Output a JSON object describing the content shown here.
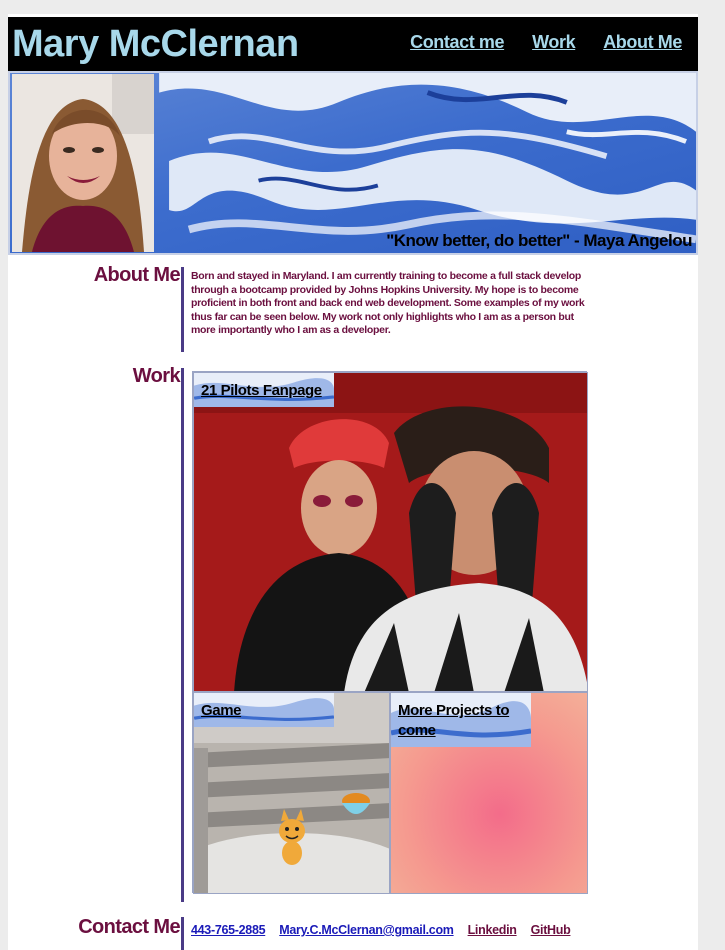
{
  "header": {
    "title": "Mary McClernan",
    "nav": [
      "Contact me",
      "Work",
      "About Me"
    ]
  },
  "hero": {
    "quote": "\"Know better, do better\" - Maya Angelou"
  },
  "about": {
    "heading": "About Me",
    "text": "Born and stayed in Maryland. I am currently training to become a full stack develop through a bootcamp provided by Johns Hopkins University. My hope is to become proficient in both front and back end web development. Some examples of my work thus far can be seen below. My work not only highlights who I am as a person but more importantly who I am as a developer."
  },
  "work": {
    "heading": "Work",
    "projects": [
      {
        "label": "21 Pilots Fanpage"
      },
      {
        "label": "Game"
      },
      {
        "label": "More Projects to come"
      }
    ]
  },
  "contact": {
    "heading": "Contact Me",
    "phone": "443-765-2885",
    "email": "Mary.C.McClernan@gmail.com",
    "linkedin": "Linkedin",
    "github": "GitHub"
  },
  "colors": {
    "title_blue": "#a8d8ea",
    "maroon": "#6b0f3f",
    "bar_purple": "#4a3b86",
    "link_blue": "#1a1ab8"
  }
}
